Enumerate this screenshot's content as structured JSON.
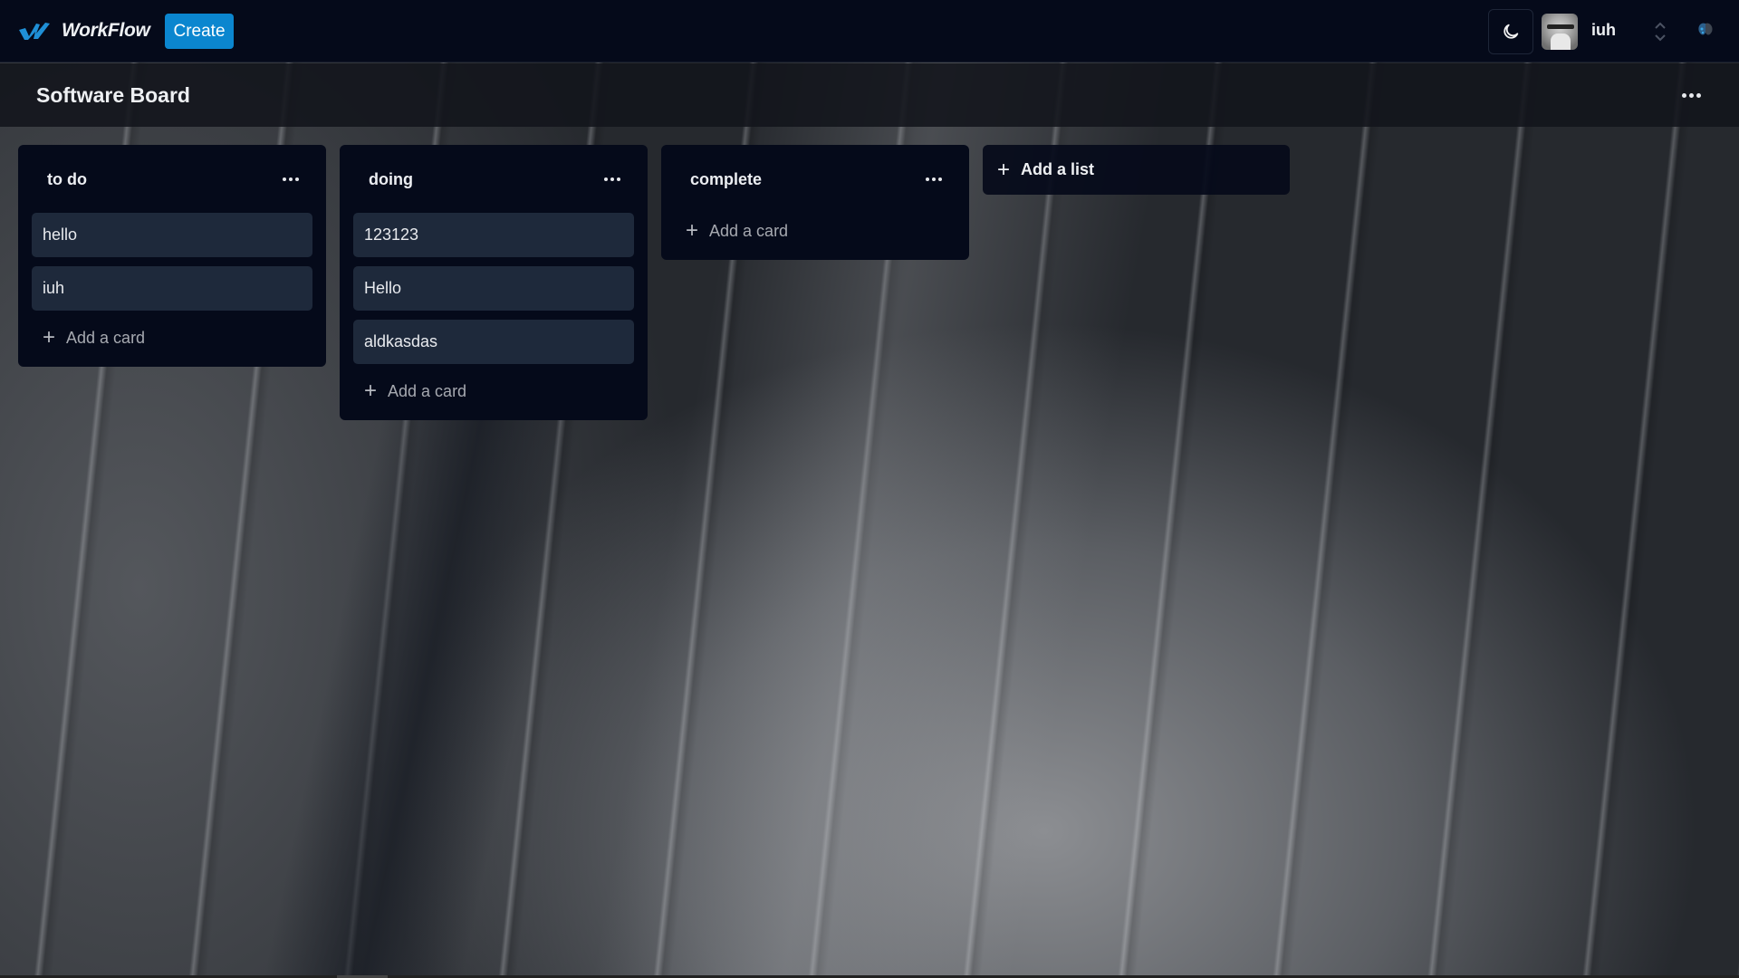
{
  "app": {
    "name": "WorkFlow",
    "create_label": "Create",
    "brand_color": "#0b86cf"
  },
  "user": {
    "name": "iuh"
  },
  "topbar_icons": {
    "theme": "moon-icon",
    "switcher": "chevron-up-down-icon",
    "extension": "butterfly-icon"
  },
  "board": {
    "title": "Software Board",
    "menu_icon": "more-horizontal-icon"
  },
  "lists": [
    {
      "title": "to do",
      "cards": [
        "hello",
        "iuh"
      ],
      "add_card_label": "Add a card"
    },
    {
      "title": "doing",
      "cards": [
        "123123",
        "Hello",
        "aldkasdas"
      ],
      "add_card_label": "Add a card"
    },
    {
      "title": "complete",
      "cards": [],
      "add_card_label": "Add a card"
    }
  ],
  "add_list_label": "Add a list"
}
